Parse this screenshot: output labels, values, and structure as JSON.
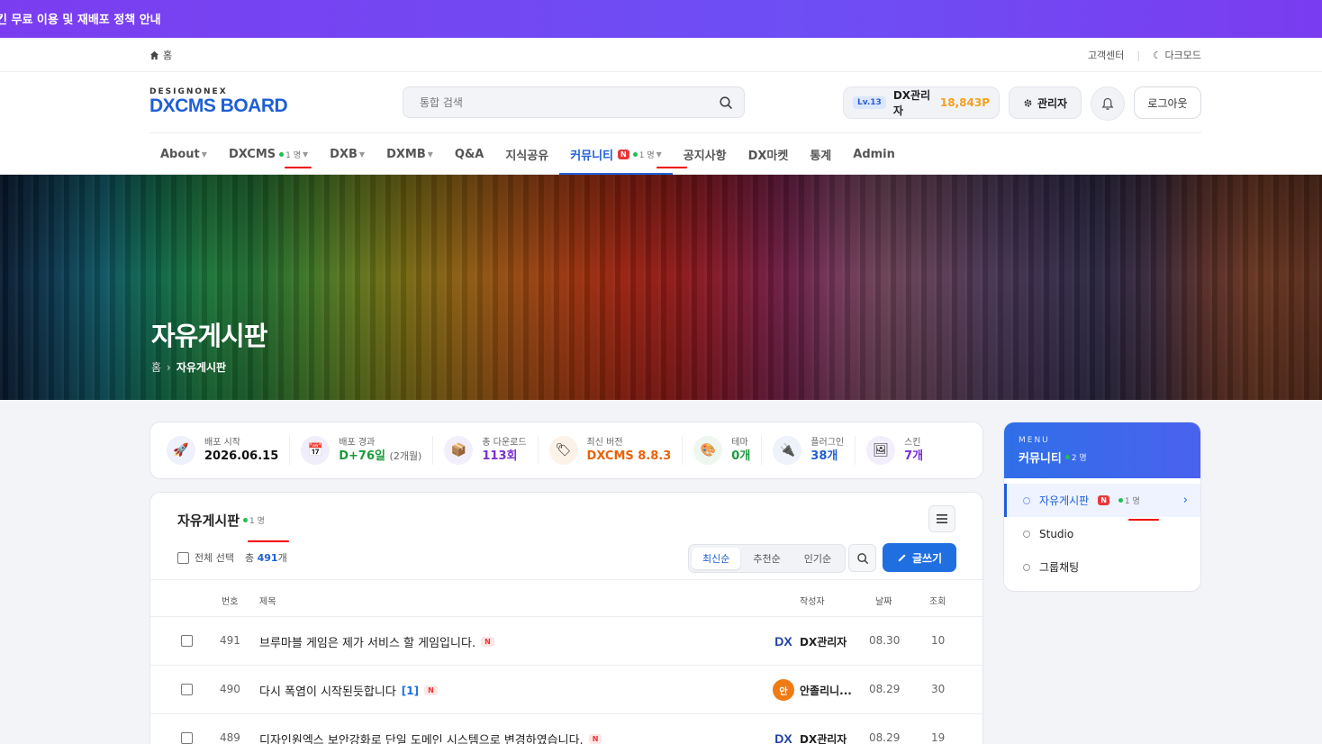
{
  "banner": {
    "text": "킨 무료 이용 및 재배포 정책 안내"
  },
  "topbar": {
    "home": "홈",
    "support": "고객센터",
    "darkmode": "다크모드"
  },
  "logo": {
    "small": "DESIGNONEX",
    "big": "DXCMS BOARD"
  },
  "search": {
    "placeholder": "통합 검색"
  },
  "user": {
    "level": "Lv.13",
    "name": "DX관리자",
    "points": "18,843P",
    "admin_label": "관리자",
    "logout_label": "로그아웃"
  },
  "nav": {
    "items": [
      {
        "label": "About"
      },
      {
        "label": "DXCMS",
        "online": "1 명"
      },
      {
        "label": "DXB"
      },
      {
        "label": "DXMB"
      },
      {
        "label": "Q&A"
      },
      {
        "label": "지식공유"
      },
      {
        "label": "커뮤니티",
        "badge": "N",
        "online": "1 명"
      },
      {
        "label": "공지사항"
      },
      {
        "label": "DX마켓"
      },
      {
        "label": "통계"
      },
      {
        "label": "Admin"
      }
    ]
  },
  "hero": {
    "title": "자유게시판",
    "crumb_home": "홈",
    "crumb_current": "자유게시판"
  },
  "stats": [
    {
      "label": "배포 시작",
      "value": "2026.06.15",
      "color": "#111111",
      "icon": "rocket-icon"
    },
    {
      "label": "배포 경과",
      "value": "D+76일",
      "sub": "(2개월)",
      "color": "#1a9a3a",
      "icon": "calendar-icon"
    },
    {
      "label": "총 다운로드",
      "value": "113회",
      "color": "#7a2fd6",
      "icon": "box-icon"
    },
    {
      "label": "최신 버전",
      "value": "DXCMS 8.8.3",
      "color": "#e8630a",
      "icon": "tag-icon"
    },
    {
      "label": "테마",
      "value": "0개",
      "color": "#1a9a3a",
      "icon": "palette-icon"
    },
    {
      "label": "플러그인",
      "value": "38개",
      "color": "#1f5fd6",
      "icon": "plug-icon"
    },
    {
      "label": "스킨",
      "value": "7개",
      "color": "#7a2fd6",
      "icon": "image-icon"
    }
  ],
  "board": {
    "title": "자유게시판",
    "online": "1 명",
    "select_all": "전체 선택",
    "total_prefix": "총",
    "total_count": "491",
    "total_suffix": "개",
    "sort": [
      "최신순",
      "추천순",
      "인기순"
    ],
    "write_label": "글쓰기",
    "columns": {
      "num": "번호",
      "title": "제목",
      "author": "작성자",
      "date": "날짜",
      "views": "조회"
    },
    "rows": [
      {
        "num": "491",
        "title": "브루마블 게임은 제가 서비스 할 게임입니다.",
        "comments": "",
        "badge": "N",
        "avatar": "DX",
        "author": "DX관리자",
        "date": "08.30",
        "views": "10"
      },
      {
        "num": "490",
        "title": "다시 폭염이 시작된듯합니다",
        "comments": "[1]",
        "badge": "N",
        "avatar": "안",
        "author": "안졸리니...",
        "date": "08.29",
        "views": "30"
      },
      {
        "num": "489",
        "title": "디자인원엑스 보안강화로 단일 도메인 시스템으로 변경하였습니다.",
        "comments": "",
        "badge": "N",
        "avatar": "DX",
        "author": "DX관리자",
        "date": "08.29",
        "views": "19"
      }
    ]
  },
  "side": {
    "menu_label": "MENU",
    "title": "커뮤니티",
    "online": "2 명",
    "items": [
      {
        "label": "자유게시판",
        "badge": "N",
        "online": "1 명"
      },
      {
        "label": "Studio"
      },
      {
        "label": "그룹채팅"
      }
    ]
  }
}
